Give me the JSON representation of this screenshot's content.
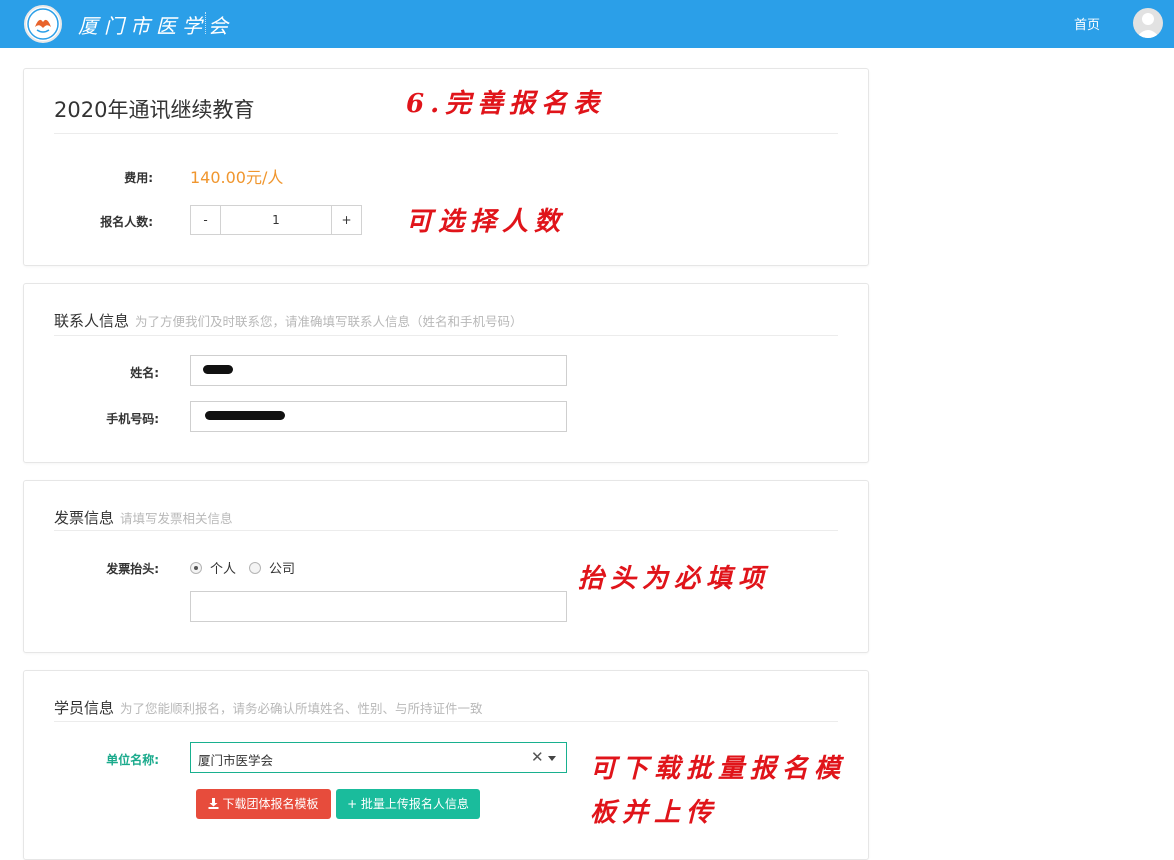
{
  "header": {
    "logo_text": "厦门市医学会",
    "nav_home": "首页"
  },
  "course": {
    "title": "2020年通讯继续教育",
    "fee_label": "费用:",
    "fee_value": "140.00元/人",
    "count_label": "报名人数:",
    "minus": "-",
    "count": "1",
    "plus": "+"
  },
  "contact": {
    "heading": "联系人信息",
    "hint": "为了方便我们及时联系您，请准确填写联系人信息（姓名和手机号码）",
    "name_label": "姓名:",
    "phone_label": "手机号码:"
  },
  "invoice": {
    "heading": "发票信息",
    "hint": "请填写发票相关信息",
    "title_label": "发票抬头:",
    "options": [
      "个人",
      "公司"
    ],
    "selected": "个人"
  },
  "student": {
    "heading": "学员信息",
    "hint": "为了您能顺利报名，请务必确认所填姓名、性别、与所持证件一致",
    "unit_label": "单位名称:",
    "unit_value": "厦门市医学会",
    "clear_symbol": "✕",
    "download_button": "下载团体报名模板",
    "upload_button": "+ 批量上传报名人信息"
  },
  "annotations": {
    "a1": "6.完善报名表",
    "a2": "可选择人数",
    "a3": "抬头为必填项",
    "a4_line1": "可下载批量报名模",
    "a4_line2": "板并上传"
  },
  "colors": {
    "header_bg": "#2b9fe8",
    "price": "#f0962e",
    "accent_green": "#1abc9c",
    "download_red": "#e74c3c",
    "annotation_red": "#e0141a"
  }
}
